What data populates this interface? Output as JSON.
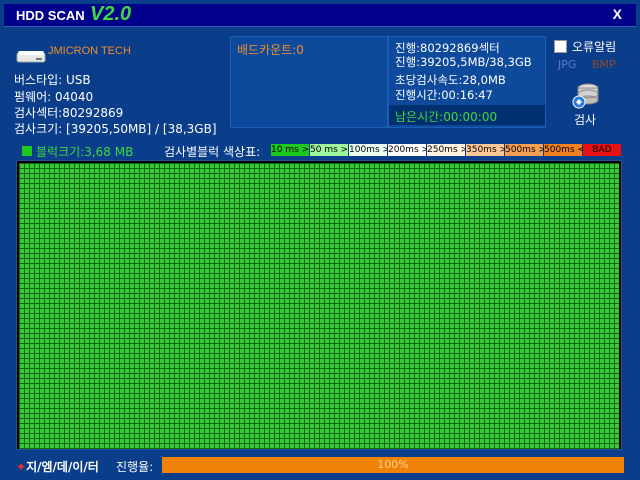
{
  "title": {
    "app_name": "HDD SCAN",
    "version": "V2.0",
    "close": "X"
  },
  "device": {
    "brand": "JMICRON TECH",
    "bus_type": "버스타입: USB",
    "firmware": "펌웨어: 04040",
    "sectors": "검사섹터:80292869",
    "size": "검사크기: [39205,50MB] / [38,3GB]"
  },
  "status": {
    "bad_count": "배드카운트:0",
    "progress_sectors": "진행:80292869섹터",
    "progress_size": "진행:39205,5MB/38,3GB",
    "speed": "초당검사속도:28,0MB",
    "elapsed": "진행시간:00:16:47",
    "remaining": "남은시간:00:00:00"
  },
  "options": {
    "error_alarm_label": "오류알림",
    "error_alarm_checked": false,
    "format_jpg": "JPG",
    "format_bmp": "BMP",
    "scan_button": "검사"
  },
  "legend": {
    "block_size": "블럭크기:3,68 MB",
    "title": "검사별블럭 색상표:",
    "items": [
      {
        "label": "10 ms >",
        "color": "#1ec81e"
      },
      {
        "label": "50 ms >",
        "color": "#9ef59e"
      },
      {
        "label": "100ms >",
        "color": "#e8fff0"
      },
      {
        "label": "200ms >",
        "color": "#ffffff"
      },
      {
        "label": "250ms >",
        "color": "#fff2e0"
      },
      {
        "label": "350ms >",
        "color": "#ffc896"
      },
      {
        "label": "500ms >",
        "color": "#f5a050"
      },
      {
        "label": "500ms <",
        "color": "#f08020"
      },
      {
        "label": "BAD",
        "color": "#e81010"
      }
    ]
  },
  "footer": {
    "brand": "지/엠/데/이/터",
    "progress_label": "진행율:",
    "progress_value": "100%",
    "progress_fraction": 1.0
  },
  "colors": {
    "accent_green": "#3fd93f",
    "accent_orange": "#f08c2c",
    "background": "#0a3d8a",
    "block_good": "#38c838"
  }
}
